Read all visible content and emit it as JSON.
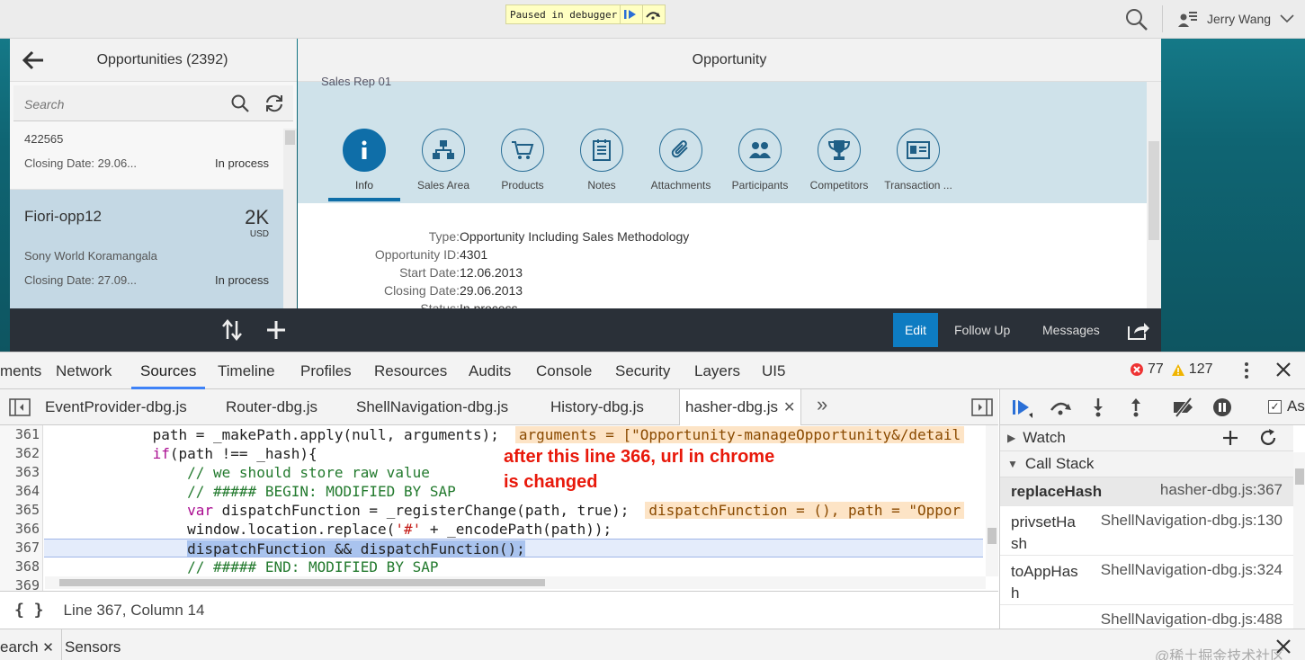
{
  "debugger_banner": {
    "text": "Paused in debugger"
  },
  "shell": {
    "user_name": "Jerry Wang"
  },
  "master": {
    "title": "Opportunities (2392)",
    "search_placeholder": "Search",
    "items": [
      {
        "id": "422565",
        "closing": "Closing Date: 29.06...",
        "status": "In process"
      },
      {
        "title": "Fiori-opp12",
        "amount": "2K",
        "currency": "USD",
        "account": "Sony World Koramangala",
        "closing": "Closing Date: 27.09...",
        "status": "In process"
      }
    ]
  },
  "detail": {
    "title": "Opportunity",
    "clipped_text": "Sales Rep 01",
    "tabs": [
      "Info",
      "Sales Area",
      "Products",
      "Notes",
      "Attachments",
      "Participants",
      "Competitors",
      "Transaction ..."
    ],
    "fields": [
      {
        "label": "Type:",
        "value": "Opportunity Including Sales Methodology"
      },
      {
        "label": "Opportunity ID:",
        "value": "4301"
      },
      {
        "label": "Start Date:",
        "value": "12.06.2013"
      },
      {
        "label": "Closing Date:",
        "value": "29.06.2013"
      },
      {
        "label": "Status:",
        "value": "In process"
      }
    ]
  },
  "footer": {
    "edit": "Edit",
    "follow_up": "Follow Up",
    "messages": "Messages"
  },
  "devtools": {
    "tabs": [
      "ments",
      "Network",
      "Sources",
      "Timeline",
      "Profiles",
      "Resources",
      "Audits",
      "Console",
      "Security",
      "Layers",
      "UI5"
    ],
    "active_tab": "Sources",
    "errors": "77",
    "warnings": "127",
    "file_tabs": [
      "EventProvider-dbg.js",
      "Router-dbg.js",
      "ShellNavigation-dbg.js",
      "History-dbg.js",
      "hasher-dbg.js"
    ],
    "line_numbers": [
      "361",
      "362",
      "363",
      "364",
      "365",
      "366",
      "367",
      "368",
      "369"
    ],
    "code": {
      "l361": "            path = _makePath.apply(null, arguments);",
      "l361_inline": "arguments = [\"Opportunity-manageOpportunity&/detail",
      "l362_a": "            ",
      "l362_kw": "if",
      "l362_b": "(path !== _hash){",
      "l363": "                // we should store raw value",
      "l364": "                // ##### BEGIN: MODIFIED BY SAP",
      "l365_kw": "var",
      "l365_b": " dispatchFunction = _registerChange(path, true);",
      "l365_inline": "dispatchFunction = (), path = \"Oppor",
      "l366_a": "                window.location.replace(",
      "l366_str": "'#'",
      "l366_b": " + _encodePath(path));",
      "l367": "dispatchFunction && dispatchFunction();",
      "l368": "                // ##### END: MODIFIED BY SAP"
    },
    "annotation_line1": "after this line 366, url in chrome",
    "annotation_line2": "is changed",
    "status": "Line 367, Column 14",
    "watch_label": "Watch",
    "callstack_label": "Call Stack",
    "async_label": "Asy",
    "call_stack": [
      {
        "fn": "replaceHash",
        "loc": "hasher-dbg.js:367"
      },
      {
        "fn": "privsetHash",
        "loc": "ShellNavigation-dbg.js:130"
      },
      {
        "fn": "toAppHash",
        "loc": "ShellNavigation-dbg.js:324"
      },
      {
        "fn": "",
        "loc": "ShellNavigation-dbg.js:488"
      }
    ],
    "drawer_tabs": [
      "earch",
      "Sensors"
    ],
    "watermark": "@稀土掘金技术社区"
  },
  "colors": {
    "accent": "#0e7cc2",
    "annotation": "#e8180a",
    "devtools_tab_active": "#3e82f7"
  }
}
